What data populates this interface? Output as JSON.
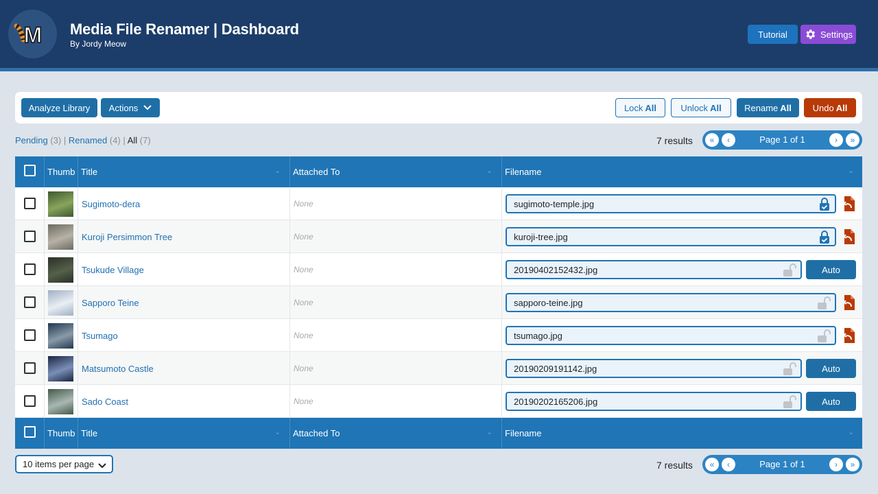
{
  "app": {
    "title": "Media File Renamer | Dashboard",
    "subtitle": "By Jordy Meow",
    "logo_letter": "M",
    "tutorial_label": "Tutorial",
    "settings_label": "Settings"
  },
  "toolbar": {
    "analyze_label": "Analyze Library",
    "actions_label": "Actions",
    "lock_prefix": "Lock",
    "lock_bold": "All",
    "unlock_prefix": "Unlock",
    "unlock_bold": "All",
    "rename_prefix": "Rename",
    "rename_bold": "All",
    "undo_prefix": "Undo",
    "undo_bold": "All"
  },
  "filters": {
    "pending_label": "Pending",
    "pending_count": "(3)",
    "renamed_label": "Renamed",
    "renamed_count": "(4)",
    "all_label": "All",
    "all_count": "(7)",
    "separator": "|"
  },
  "pagination": {
    "results_text": "7 results",
    "page_text": "Page 1 of 1"
  },
  "table": {
    "columns": {
      "thumb": "Thumb",
      "title": "Title",
      "attached": "Attached To",
      "filename": "Filename"
    },
    "auto_label": "Auto",
    "rows": [
      {
        "title": "Sugimoto-dera",
        "attached": "None",
        "filename": "sugimoto-temple.jpg",
        "status": "locked",
        "thumb_colors": [
          "#3c5a2e",
          "#8aa35d"
        ]
      },
      {
        "title": "Kuroji Persimmon Tree",
        "attached": "None",
        "filename": "kuroji-tree.jpg",
        "status": "locked",
        "thumb_colors": [
          "#6b6a63",
          "#b7b2a5"
        ]
      },
      {
        "title": "Tsukude Village",
        "attached": "None",
        "filename": "20190402152432.jpg",
        "status": "pending",
        "thumb_colors": [
          "#2a2f26",
          "#55604a"
        ]
      },
      {
        "title": "Sapporo Teine",
        "attached": "None",
        "filename": "sapporo-teine.jpg",
        "status": "unlocked",
        "thumb_colors": [
          "#9fb0c4",
          "#e9eef3"
        ]
      },
      {
        "title": "Tsumago",
        "attached": "None",
        "filename": "tsumago.jpg",
        "status": "unlocked",
        "thumb_colors": [
          "#1f3850",
          "#8a9aa8"
        ]
      },
      {
        "title": "Matsumoto Castle",
        "attached": "None",
        "filename": "20190209191142.jpg",
        "status": "pending",
        "thumb_colors": [
          "#1a2540",
          "#7a8fb8"
        ]
      },
      {
        "title": "Sado Coast",
        "attached": "None",
        "filename": "20190202165206.jpg",
        "status": "pending",
        "thumb_colors": [
          "#445a48",
          "#a9b7b3"
        ]
      }
    ]
  },
  "footer": {
    "per_page_label": "10 items per page"
  },
  "colors": {
    "header_bg": "#1c3d6a",
    "primary": "#1f6fa6",
    "danger": "#b83a06",
    "settings": "#8a4cd6",
    "table_header": "#1f75b5"
  }
}
